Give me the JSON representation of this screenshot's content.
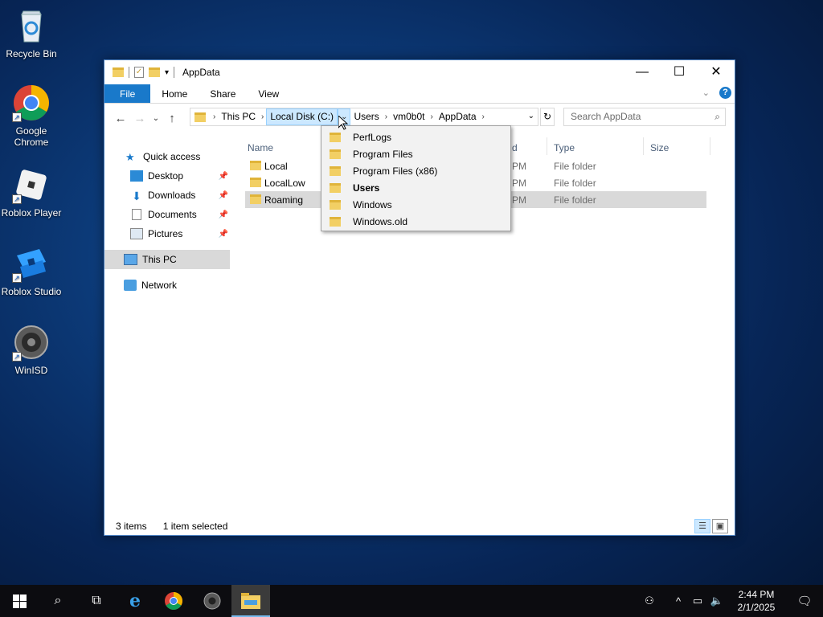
{
  "desktop": {
    "icons": [
      {
        "label": "Recycle Bin"
      },
      {
        "label": "Google Chrome"
      },
      {
        "label": "Roblox Player"
      },
      {
        "label": "Roblox Studio"
      },
      {
        "label": "WinISD"
      }
    ]
  },
  "window": {
    "title": "AppData",
    "ribbon_tabs": [
      "File",
      "Home",
      "Share",
      "View"
    ],
    "help": "?",
    "address": {
      "crumbs": [
        "This PC",
        "Local Disk (C:)",
        "Users",
        "vm0b0t",
        "AppData"
      ]
    },
    "search_placeholder": "Search AppData",
    "nav_pane": {
      "quick_access": "Quick access",
      "items": [
        {
          "label": "Desktop",
          "pinned": true
        },
        {
          "label": "Downloads",
          "pinned": true
        },
        {
          "label": "Documents",
          "pinned": true
        },
        {
          "label": "Pictures",
          "pinned": true
        }
      ],
      "this_pc": "This PC",
      "network": "Network"
    },
    "columns": {
      "name": "Name",
      "date_partial": "d",
      "type": "Type",
      "size": "Size"
    },
    "files": [
      {
        "name": "Local",
        "date_partial": "PM",
        "type": "File folder"
      },
      {
        "name": "LocalLow",
        "date_partial": "PM",
        "type": "File folder"
      },
      {
        "name": "Roaming",
        "date_partial": "PM",
        "type": "File folder",
        "selected": true
      }
    ],
    "status": {
      "items": "3 items",
      "selected": "1 item selected"
    }
  },
  "dropdown": {
    "items": [
      {
        "label": "PerfLogs"
      },
      {
        "label": "Program Files"
      },
      {
        "label": "Program Files (x86)"
      },
      {
        "label": "Users",
        "bold": true
      },
      {
        "label": "Windows"
      },
      {
        "label": "Windows.old"
      }
    ]
  },
  "taskbar": {
    "clock_time": "2:44 PM",
    "clock_date": "2/1/2025"
  }
}
